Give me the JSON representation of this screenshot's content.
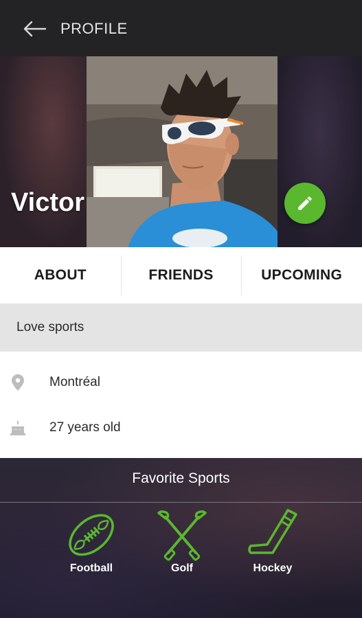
{
  "header": {
    "title": "PROFILE"
  },
  "profile": {
    "name": "Victor",
    "bio": "Love sports"
  },
  "tabs": [
    {
      "label": "ABOUT"
    },
    {
      "label": "FRIENDS"
    },
    {
      "label": "UPCOMING"
    }
  ],
  "info": [
    {
      "icon": "location-pin-icon",
      "text": "Montréal"
    },
    {
      "icon": "birthday-cake-icon",
      "text": "27 years old"
    }
  ],
  "favorite_sports": {
    "title": "Favorite Sports",
    "items": [
      {
        "label": "Football",
        "icon": "football-icon"
      },
      {
        "label": "Golf",
        "icon": "golf-clubs-icon"
      },
      {
        "label": "Hockey",
        "icon": "hockey-stick-icon"
      }
    ]
  },
  "colors": {
    "accent": "#5ab82e",
    "topbar": "#232326",
    "tab_text": "#1b1b1b",
    "bio_bg": "#e4e4e4"
  }
}
